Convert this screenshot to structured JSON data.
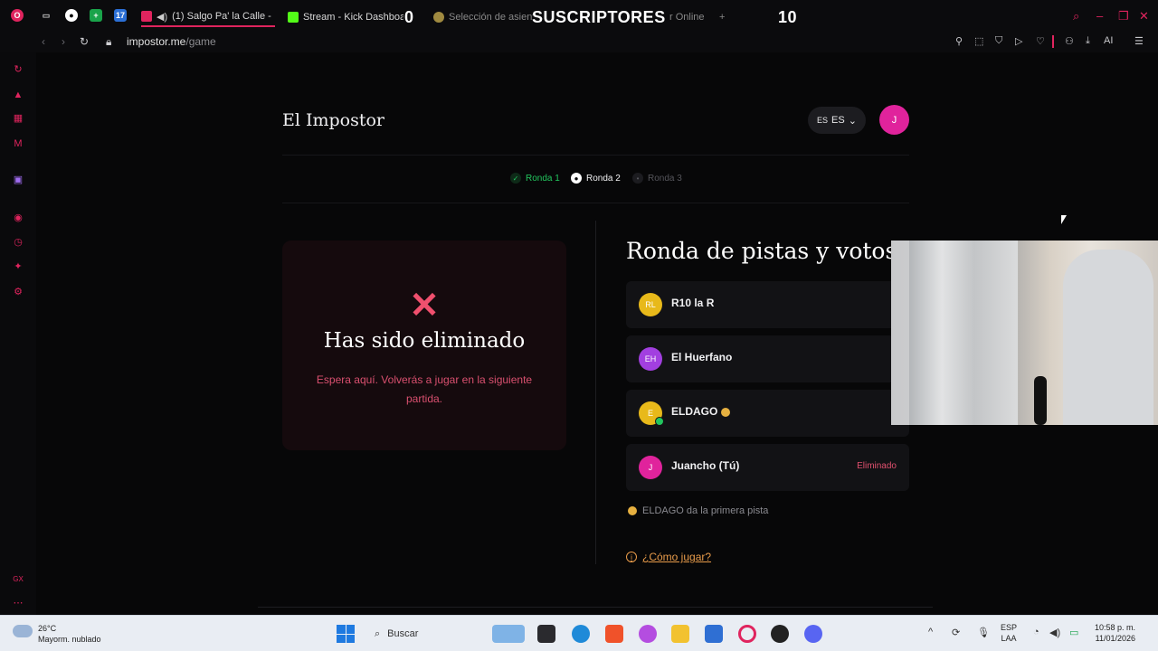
{
  "browser": {
    "tabs": [
      {
        "label": "(1) Salgo Pa' la Calle -",
        "active": true
      },
      {
        "label": "Stream - Kick Dashboard"
      },
      {
        "label": "Selección de asient"
      },
      {
        "label": "r Online"
      }
    ],
    "overlay_counter_left": "0",
    "overlay_title": "SUSCRIPTORES",
    "overlay_counter_right": "10",
    "url_domain": "impostor.me",
    "url_path": "/game",
    "ai_label": "AI"
  },
  "app": {
    "brand": "El Impostor",
    "language_flag": "ES",
    "language": "ES",
    "user_initial": "J",
    "rounds": [
      {
        "label": "Ronda 1",
        "state": "done"
      },
      {
        "label": "Ronda 2",
        "state": "current"
      },
      {
        "label": "Ronda 3",
        "state": "pending"
      }
    ],
    "eliminated_card": {
      "icon": "✕",
      "title": "Has sido eliminado",
      "message": "Espera aquí. Volverás a jugar en la siguiente partida."
    },
    "section_title": "Ronda de pistas y votos",
    "players": [
      {
        "initials": "RL",
        "name": "R10 la R",
        "color": "#e8b91a",
        "tag": ""
      },
      {
        "initials": "EH",
        "name": "El Huerfano",
        "color": "#a23fe0",
        "tag": ""
      },
      {
        "initials": "E",
        "name": "ELDAGO",
        "color": "#e8b91a",
        "tag": ""
      },
      {
        "initials": "J",
        "name": "Juancho (Tú)",
        "color": "#e0239c",
        "tag": "Eliminado"
      }
    ],
    "first_clue_hint": "ELDAGO da la primera pista",
    "how_to_play": "¿Cómo jugar?"
  },
  "taskbar": {
    "weather_temp": "26°C",
    "weather_desc": "Mayorm. nublado",
    "search_placeholder": "Buscar",
    "lang_top": "ESP",
    "lang_bottom": "LAA",
    "time": "10:58 p. m.",
    "date": "11/01/2026"
  },
  "colors": {
    "accent": "#e0245e",
    "round_done": "#22c55e",
    "eliminated_text": "#d9506f",
    "howto": "#e89b4a"
  }
}
